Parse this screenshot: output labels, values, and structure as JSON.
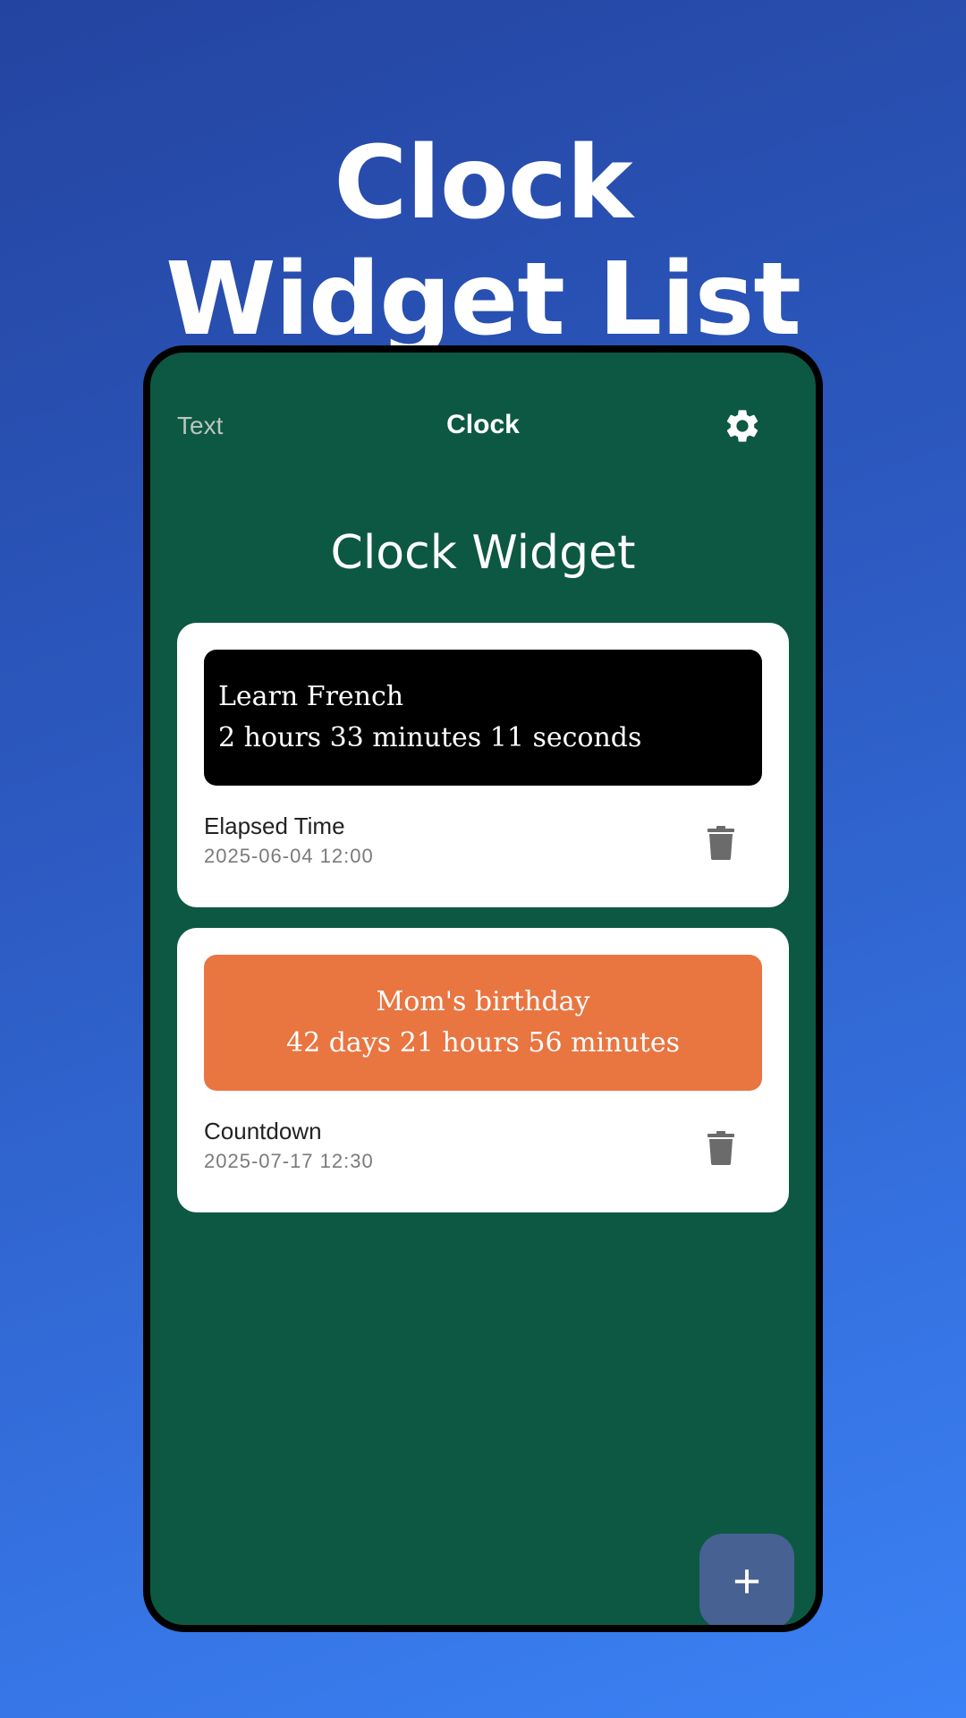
{
  "headline": {
    "line1": "Clock",
    "line2": "Widget List"
  },
  "app": {
    "topbar": {
      "left_text": "Text",
      "title": "Clock",
      "settings_icon": "gear-icon"
    },
    "screen_title": "Clock Widget",
    "widgets": [
      {
        "preview_line1": "Learn French",
        "preview_line2": "2 hours 33 minutes 11 seconds",
        "preview_bg": "#000000",
        "type": "Elapsed Time",
        "date": "2025-06-04 12:00",
        "delete_icon": "trash-icon"
      },
      {
        "preview_line1": "Mom's birthday",
        "preview_line2": "42 days 21 hours 56 minutes",
        "preview_bg": "#e97541",
        "type": "Countdown",
        "date": "2025-07-17 12:30",
        "delete_icon": "trash-icon"
      }
    ],
    "fab": {
      "label": "+"
    }
  },
  "colors": {
    "app_background": "#0d5842",
    "fab": "#466192",
    "accent_orange": "#e97541"
  }
}
